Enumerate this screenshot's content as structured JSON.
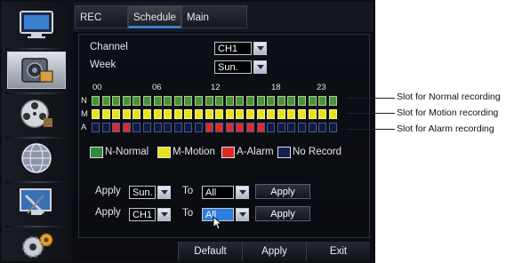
{
  "tabs": [
    "REC Para",
    "Schedule",
    "Main Stream"
  ],
  "active_tab": 1,
  "sidebar_icons": [
    "monitor-icon",
    "record-settings-icon",
    "camera-reel-icon",
    "network-globe-icon",
    "system-tools-icon",
    "gear-settings-icon"
  ],
  "form": {
    "channel_label": "Channel",
    "channel_value": "CH1",
    "week_label": "Week",
    "week_value": "Sun."
  },
  "hour_labels": [
    "00",
    "06",
    "12",
    "18",
    "23"
  ],
  "row_labels": [
    "N",
    "M",
    "A"
  ],
  "schedule": {
    "hours": 24,
    "normal": [
      1,
      1,
      1,
      1,
      1,
      1,
      1,
      1,
      1,
      1,
      1,
      1,
      1,
      1,
      1,
      1,
      1,
      1,
      1,
      1,
      1,
      1,
      1,
      1
    ],
    "motion": [
      1,
      1,
      1,
      1,
      1,
      1,
      1,
      1,
      1,
      1,
      1,
      1,
      1,
      1,
      1,
      1,
      1,
      1,
      1,
      1,
      1,
      1,
      1,
      1
    ],
    "alarm": [
      0,
      0,
      1,
      1,
      0,
      0,
      0,
      0,
      0,
      0,
      0,
      1,
      1,
      1,
      1,
      1,
      1,
      0,
      0,
      0,
      0,
      0,
      0,
      0
    ]
  },
  "legend": [
    {
      "label": "N-Normal",
      "color": "#2f8a3a"
    },
    {
      "label": "M-Motion",
      "color": "#e8e21a"
    },
    {
      "label": "A-Alarm",
      "color": "#e02a2a"
    },
    {
      "label": "No Record",
      "color": "#14204f"
    }
  ],
  "colors": {
    "normal": "#4c8f3c",
    "motion": "#e8e21a",
    "alarm": "#e02a2a",
    "none": "#101a40",
    "accent": "#3a7fd0"
  },
  "apply_rows": [
    {
      "label": "Apply",
      "from": "Sun.",
      "to_label": "To",
      "to": "All",
      "button": "Apply"
    },
    {
      "label": "Apply",
      "from": "CH1",
      "to_label": "To",
      "to": "All",
      "button": "Apply"
    }
  ],
  "bottom_buttons": [
    "Default",
    "Apply",
    "Exit"
  ],
  "callouts": [
    "Slot for Normal recording",
    "Slot for Motion recording",
    "Slot for Alarm recording"
  ]
}
